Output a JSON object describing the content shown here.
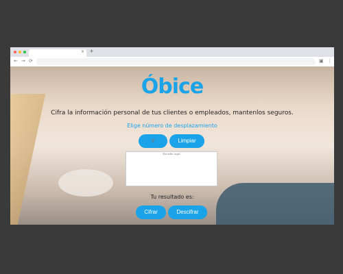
{
  "browser": {
    "new_tab": "+",
    "close_tab": "×"
  },
  "page": {
    "logo": "Óbice",
    "subtitle": "Cifra la información personal de tus clientes o empleados, mantenlos seguros.",
    "shift_label": "Elige número de desplazamiento",
    "shift_placeholder": "#",
    "clear_button": "Limpiar",
    "text_placeholder": "Escribe aquí",
    "result_label": "Tu resultado es:",
    "encrypt_button": "Cifrar",
    "decrypt_button": "Descifrar"
  },
  "colors": {
    "accent": "#1aa3e8"
  }
}
